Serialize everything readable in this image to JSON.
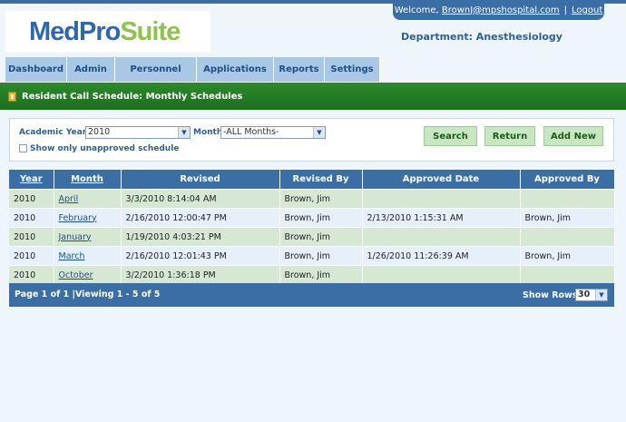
{
  "header": {
    "logo_part1": "MedPro",
    "logo_part2": "Suite",
    "welcome_prefix": "Welcome,",
    "user_email": "BrownJ@mpshospital.com",
    "separator": "|",
    "logout": "Logout",
    "department_label": "Department: Anesthesiology"
  },
  "nav": {
    "tabs": [
      {
        "label": "Dashboard"
      },
      {
        "label": "Admin"
      },
      {
        "label": "Personnel"
      },
      {
        "label": "Applications"
      },
      {
        "label": "Reports"
      },
      {
        "label": "Settings"
      }
    ]
  },
  "page": {
    "title": "Resident Call Schedule: Monthly Schedules"
  },
  "filters": {
    "year_label": "Academic Year",
    "year_value": "2010",
    "month_label": "Month",
    "month_value": "-ALL Months-",
    "unapproved_label": "Show only unapproved schedule",
    "unapproved_checked": false,
    "search_label": "Search",
    "return_label": "Return",
    "add_new_label": "Add New"
  },
  "table": {
    "headers": [
      "Year",
      "Month",
      "Revised",
      "Revised By",
      "Approved Date",
      "Approved By"
    ],
    "rows": [
      {
        "year": "2010",
        "month": "April",
        "revised": "3/3/2010 8:14:04 AM",
        "revised_by": "Brown, Jim",
        "approved_date": "",
        "approved_by": ""
      },
      {
        "year": "2010",
        "month": "February",
        "revised": "2/16/2010 12:00:47 PM",
        "revised_by": "Brown, Jim",
        "approved_date": "2/13/2010 1:15:31 AM",
        "approved_by": "Brown, Jim"
      },
      {
        "year": "2010",
        "month": "January",
        "revised": "1/19/2010 4:03:21 PM",
        "revised_by": "Brown, Jim",
        "approved_date": "",
        "approved_by": ""
      },
      {
        "year": "2010",
        "month": "March",
        "revised": "2/16/2010 12:01:43 PM",
        "revised_by": "Brown, Jim",
        "approved_date": "1/26/2010 11:26:39 AM",
        "approved_by": "Brown, Jim"
      },
      {
        "year": "2010",
        "month": "October",
        "revised": "3/2/2010 1:36:18 PM",
        "revised_by": "Brown, Jim",
        "approved_date": "",
        "approved_by": ""
      }
    ]
  },
  "pager": {
    "info": "Page 1 of 1 |Viewing 1 - 5 of 5",
    "show_rows_label": "Show Rows",
    "show_rows_value": "30"
  },
  "colors": {
    "header_blue": "#3b6ea5",
    "nav_tab": "#a9c8e6",
    "title_bar_green": "#1d6e1d",
    "button_green": "#c7e6c2",
    "logo_blue": "#2e67ad",
    "logo_green": "#8fc24a"
  }
}
